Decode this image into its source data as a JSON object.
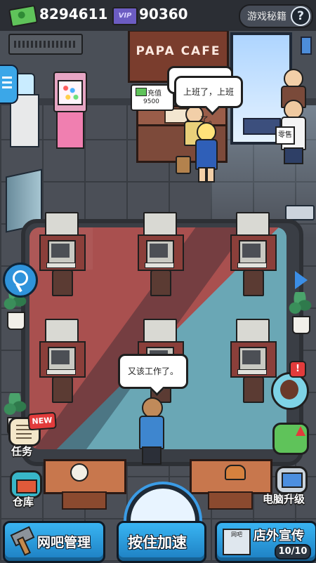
{
  "topbar": {
    "money": "8294611",
    "vip_badge": "VIP",
    "vip_points": "90360",
    "guide_label": "游戏秘籍",
    "help_glyph": "?"
  },
  "scene": {
    "cafe_sign": "PAPA CAFE",
    "price_tag": {
      "label": "充值",
      "value": "9500"
    },
    "bubble_receptionist": "上班了，上班了。",
    "bubble_worker": "又该工作了。",
    "queue_sign": "零售"
  },
  "side_menu": {
    "new_badge": "NEW",
    "tasks_label": "任务",
    "warehouse_label": "仓库",
    "notice_badge": "!",
    "pc_upgrade_label": "电脑升级"
  },
  "bottom_bar": {
    "manage_label": "网吧管理",
    "speedup_label": "按住加速",
    "promo_label": "店外宣传",
    "promo_sign": "网吧",
    "promo_progress": "10/10"
  },
  "colors": {
    "accent_blue": "#39b4f2",
    "money_green": "#5fc35a",
    "carpet_red": "#a9504f",
    "carpet_teal": "#6aa7b5",
    "alert_red": "#e23b3b"
  },
  "icons": [
    "cash-icon",
    "vip-icon",
    "help-icon",
    "menu-icon",
    "wrench-icon",
    "arrow-right-icon",
    "hammer-icon",
    "warehouse-icon",
    "tasks-icon",
    "pc-upgrade-icon"
  ]
}
